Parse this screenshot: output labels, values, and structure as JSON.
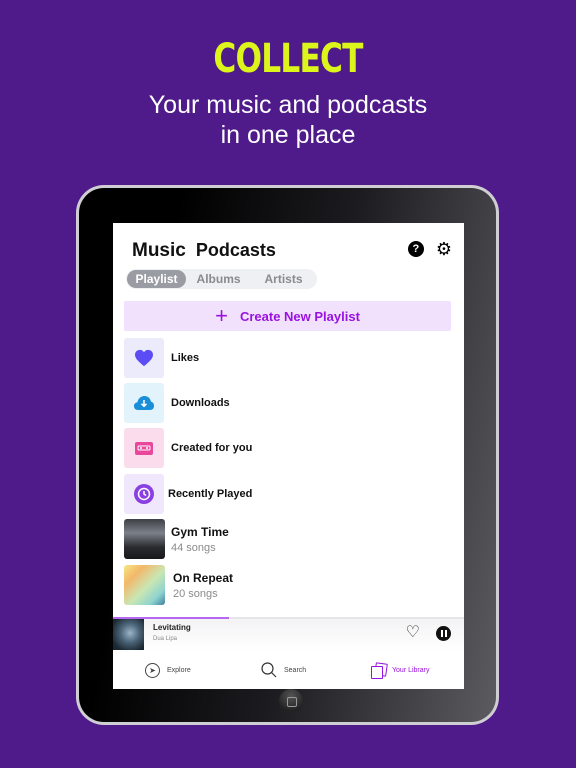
{
  "promo": {
    "headline": "COLLECT",
    "subline_1": "Your music and podcasts",
    "subline_2": "in one place"
  },
  "header": {
    "tabs": [
      {
        "label": "Music",
        "active": true
      },
      {
        "label": "Podcasts",
        "active": false
      }
    ],
    "help_icon": "?",
    "settings_icon": "⚙"
  },
  "segment": {
    "items": [
      {
        "label": "Playlist",
        "active": true
      },
      {
        "label": "Albums",
        "active": false
      },
      {
        "label": "Artists",
        "active": false
      }
    ]
  },
  "create_playlist": {
    "icon": "+",
    "label": "Create New Playlist"
  },
  "library": [
    {
      "label": "Likes",
      "icon": "heart-icon",
      "tile_color": "#ebebfb",
      "icon_color": "#5b4cf5"
    },
    {
      "label": "Downloads",
      "icon": "cloud-download-icon",
      "tile_color": "#e2f3fc",
      "icon_color": "#1a8fd8"
    },
    {
      "label": "Created for you",
      "icon": "cassette-icon",
      "tile_color": "#fbdcec",
      "icon_color": "#e8479b"
    },
    {
      "label": "Recently Played",
      "icon": "history-icon",
      "tile_color": "#f1e7fc",
      "icon_color": "#8a3fe3"
    }
  ],
  "playlists": [
    {
      "title": "Gym Time",
      "subtitle": "44 songs"
    },
    {
      "title": "On Repeat",
      "subtitle": "20 songs"
    }
  ],
  "now_playing": {
    "track": "Levitating",
    "artist": "Dua Lipa",
    "progress": 0.33,
    "like_icon": "♡"
  },
  "tabbar": {
    "items": [
      {
        "label": "Explore",
        "active": false
      },
      {
        "label": "Search",
        "active": false
      },
      {
        "label": "Your Library",
        "active": true
      }
    ]
  },
  "colors": {
    "background": "#4f1a8a",
    "headline": "#dcf51a",
    "accent": "#9a12e0"
  }
}
